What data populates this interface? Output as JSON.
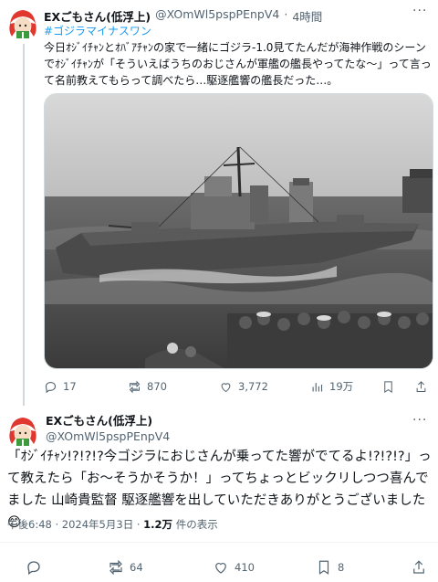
{
  "reply": {
    "display_name": "EXごもさん(低浮上)",
    "handle": "@XOmWl5pspPEnpV4",
    "separator": "·",
    "time": "4時間",
    "hashtag": "#ゴジラマイナスワン",
    "body": "今日ｵｼﾞｲﾁｬﾝとｵﾊﾞｱﾁｬﾝの家で一緒にゴジラ-1.0見てたんだが海神作戦のシーンでｵｼﾞｲﾁｬﾝが「そういえばうちのおじさんが軍艦の艦長やってたな〜」って言って名前教えてもらって調べたら…駆逐艦響の艦長だった…。",
    "stats": {
      "replies": "17",
      "reposts": "870",
      "likes": "3,772",
      "views": "19万"
    }
  },
  "main": {
    "display_name": "EXごもさん(低浮上)",
    "handle": "@XOmWl5pspPEnpV4",
    "body": "「ｵｼﾞｲﾁｬﾝ!?!?!?今ゴジラにおじさんが乗ってた響がでてるよ!?!?!?」って教えたら「お〜そうかそうか！」ってちょっとビックリしつつ喜んでました 山崎貴監督 駆逐艦響を出していただきありがとうございました😊",
    "time": "午後6:48 · 2024年5月3日 · ",
    "views_count": "1.2万",
    "views_label": " 件の表示",
    "stats": {
      "reposts": "64",
      "likes": "410",
      "bookmarks": "8"
    }
  },
  "colors": {
    "accent": "#1d9bf0",
    "secondary_text": "#536471",
    "divider": "#eff3f4"
  }
}
